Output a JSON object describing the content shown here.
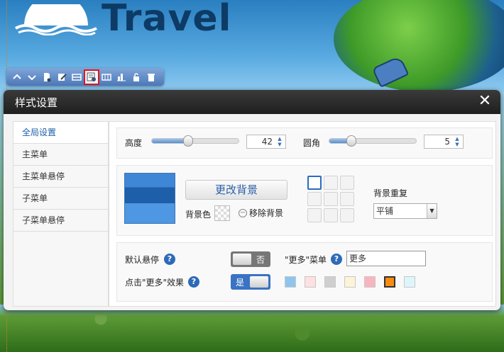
{
  "logo": {
    "text": "Travel"
  },
  "toolbar": {
    "buttons": [
      "move-up",
      "move-down",
      "add-page",
      "edit-page",
      "layout",
      "style-settings",
      "columns",
      "chart",
      "lock",
      "delete"
    ]
  },
  "dialog": {
    "title": "样式设置",
    "close_label": "✕",
    "sidebar": {
      "items": [
        {
          "label": "全局设置",
          "active": true
        },
        {
          "label": "主菜单",
          "active": false
        },
        {
          "label": "主菜单悬停",
          "active": false
        },
        {
          "label": "子菜单",
          "active": false
        },
        {
          "label": "子菜单悬停",
          "active": false
        }
      ]
    },
    "size": {
      "height_label": "高度",
      "height_value": "42",
      "height_fraction": 0.42,
      "radius_label": "圆角",
      "radius_value": "5",
      "radius_fraction": 0.25
    },
    "background": {
      "change_button": "更改背景",
      "bg_color_label": "背景色",
      "remove_bg_label": "移除背景",
      "repeat_label": "背景重复",
      "repeat_value": "平铺",
      "position_selected": "top-left"
    },
    "more": {
      "default_hover_label": "默认悬停",
      "default_hover_toggle": "否",
      "more_menu_label": "\"更多\"菜单",
      "more_menu_value": "更多",
      "click_more_label": "点击\"更多\"效果",
      "click_more_toggle": "是",
      "effect_colors": [
        "#8fc4ee",
        "#fde0df",
        "#cfcfcf",
        "#fdf3d6",
        "#f8b5bf",
        "#f78c10",
        "#ddf6fc"
      ],
      "effect_selected_index": 5
    }
  }
}
